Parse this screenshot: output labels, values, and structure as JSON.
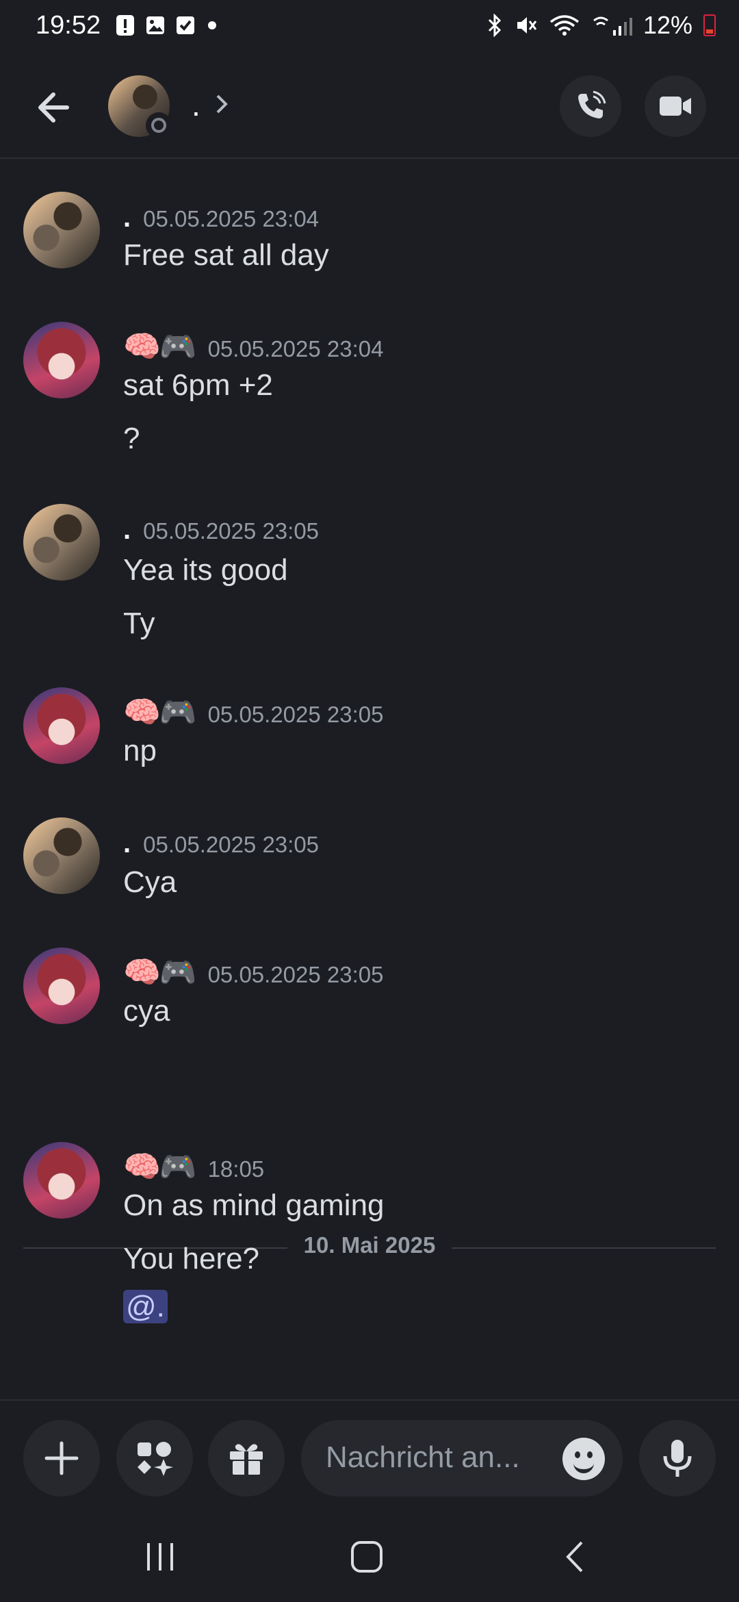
{
  "status_bar": {
    "time": "19:52",
    "battery": "12%"
  },
  "header": {
    "name": "."
  },
  "messages": [
    {
      "author": ".",
      "timestamp": "05.05.2025 23:04",
      "lines": [
        "Free sat all day"
      ]
    },
    {
      "author": "🧠🎮",
      "timestamp": "05.05.2025 23:04",
      "lines": [
        "sat 6pm +2",
        "?"
      ]
    },
    {
      "author": ".",
      "timestamp": "05.05.2025 23:05",
      "lines": [
        "Yea its good",
        "Ty"
      ]
    },
    {
      "author": "🧠🎮",
      "timestamp": "05.05.2025 23:05",
      "lines": [
        "np"
      ]
    },
    {
      "author": ".",
      "timestamp": "05.05.2025 23:05",
      "lines": [
        "Cya"
      ]
    },
    {
      "author": "🧠🎮",
      "timestamp": "05.05.2025 23:05",
      "lines": [
        "cya"
      ]
    },
    {
      "author": "🧠🎮",
      "timestamp": "18:05",
      "lines": [
        "On as mind gaming",
        "You here?"
      ],
      "mention": "@."
    }
  ],
  "date_divider": "10. Mai 2025",
  "composer": {
    "placeholder": "Nachricht an..."
  },
  "colors": {
    "background": "#1c1d22",
    "mention_bg": "#3c4280",
    "timestamp": "#949ba4"
  }
}
